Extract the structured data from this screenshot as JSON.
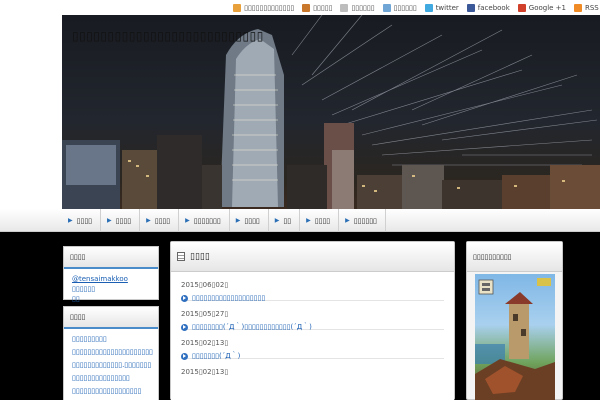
{
  "top_links": [
    {
      "icon": "home-icon",
      "label": "▯▯▯▯▯▯▯▯▯▯▯▯▯",
      "color": "#e8a13a"
    },
    {
      "icon": "profile-icon",
      "label": "▯▯▯▯▯",
      "color": "#c9772b"
    },
    {
      "icon": "mail-icon",
      "label": "▯▯▯▯▯▯",
      "color": "#bdbdbd"
    },
    {
      "icon": "sitemap-icon",
      "label": "▯▯▯▯▯▯",
      "color": "#6fa6d6"
    },
    {
      "icon": "twitter-icon",
      "label": "twitter",
      "color": "#3fa9e0"
    },
    {
      "icon": "facebook-icon",
      "label": "facebook",
      "color": "#3b5998"
    },
    {
      "icon": "google-plus-icon",
      "label": "Google +1",
      "color": "#d0402b"
    },
    {
      "icon": "rss-icon",
      "label": "RSS",
      "color": "#f08a24"
    }
  ],
  "site_title": "▯▯▯▯▯▯▯▯▯▯▯▯▯▯▯▯▯▯▯▯▯▯▯▯▯▯▯",
  "nav": [
    "▯▯▯▯",
    "▯▯▯▯",
    "▯▯▯▯",
    "▯▯▯▯▯▯▯",
    "▯▯▯▯",
    "▯▯",
    "▯▯▯▯",
    "▯▯▯▯▯▯"
  ],
  "left_box1": {
    "title": "▯▯▯▯",
    "handle": "@tensaimakkoo",
    "text_after": " ▯▯▯▯▯▯",
    "text_line2": "▯▯"
  },
  "left_box2": {
    "title": "▯▯▯▯",
    "lines": [
      "▯▯▯▯▯▯▯▯▯",
      "▯▯▯▯▯▯▯▯▯▯▯▯▯▯▯▯▯▯▯▯▯",
      "▯▯▯▯▯▯▯▯▯▯▯▯▯.▯▯▯▯▯▯▯",
      "▯▯▯▯▯▯▯▯▯▯▯▯▯▯▯",
      "▯▯▯▯▯▯▯▯▯▯▯▯▯▯▯▯▯▯"
    ]
  },
  "main": {
    "title": "▯▯▯▯",
    "posts": [
      {
        "date": "2015▯06▯02▯",
        "title": "▯▯▯▯▯▯▯▯▯▯▯▯▯▯▯▯▯▯▯"
      },
      {
        "date": "2015▯05▯27▯",
        "title": "▯▯▯▯▯▯▯▯(´Д｀)▯▯▯▯▯▯▯▯▯▯▯▯(´Д｀)"
      },
      {
        "date": "2015▯02▯13▯",
        "title": "▯▯▯▯▯▯▯(´Д｀)"
      },
      {
        "date": "2015▯02▯13▯",
        "title": ""
      }
    ]
  },
  "right_box": {
    "title": "▯▯▯▯▯▯▯▯▯▯"
  },
  "colors": {
    "accent": "#4a8cc9",
    "link": "#1a5fb4"
  }
}
